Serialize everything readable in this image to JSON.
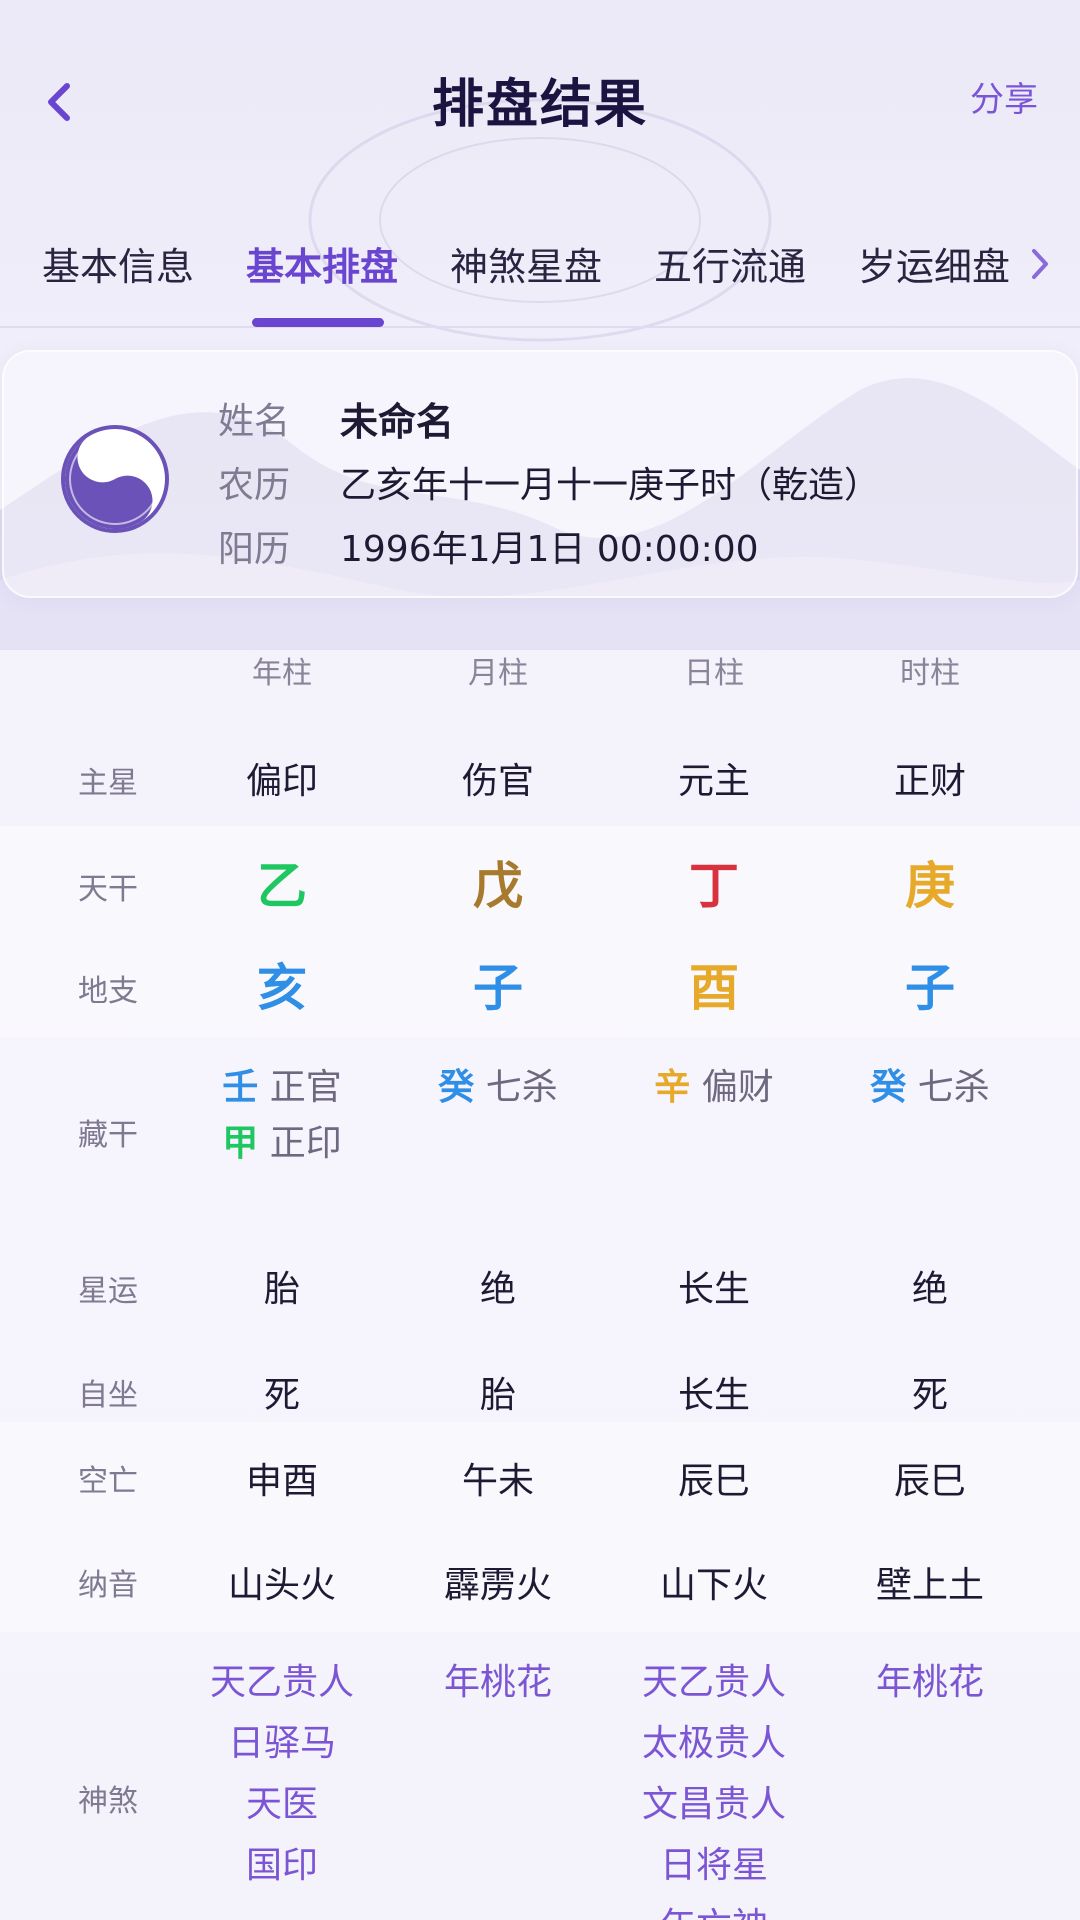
{
  "header": {
    "title": "排盘结果",
    "share_label": "分享"
  },
  "tabs": [
    {
      "label": "基本信息",
      "active": false
    },
    {
      "label": "基本排盘",
      "active": true
    },
    {
      "label": "神煞星盘",
      "active": false
    },
    {
      "label": "五行流通",
      "active": false
    },
    {
      "label": "岁运细盘",
      "active": false
    }
  ],
  "profile": {
    "name_label": "姓名",
    "name_value": "未命名",
    "lunar_label": "农历",
    "lunar_value": "乙亥年十一月十一庚子时（乾造）",
    "solar_label": "阳历",
    "solar_value": "1996年1月1日 00:00:00"
  },
  "columns": [
    "年柱",
    "月柱",
    "日柱",
    "时柱"
  ],
  "rows": {
    "main_star": {
      "label": "主星",
      "values": [
        "偏印",
        "伤官",
        "元主",
        "正财"
      ]
    },
    "heavenly_stem": {
      "label": "天干",
      "values": [
        "乙",
        "戊",
        "丁",
        "庚"
      ]
    },
    "earthly_branch": {
      "label": "地支",
      "values": [
        "亥",
        "子",
        "酉",
        "子"
      ]
    },
    "hidden_stems": {
      "label": "藏干",
      "values": [
        [
          {
            "char": "壬",
            "name": "正官"
          },
          {
            "char": "甲",
            "name": "正印"
          }
        ],
        [
          {
            "char": "癸",
            "name": "七杀"
          }
        ],
        [
          {
            "char": "辛",
            "name": "偏财"
          }
        ],
        [
          {
            "char": "癸",
            "name": "七杀"
          }
        ]
      ]
    },
    "star_fortune": {
      "label": "星运",
      "values": [
        "胎",
        "绝",
        "长生",
        "绝"
      ]
    },
    "self_seat": {
      "label": "自坐",
      "values": [
        "死",
        "胎",
        "长生",
        "死"
      ]
    },
    "void": {
      "label": "空亡",
      "values": [
        "申酉",
        "午未",
        "辰巳",
        "辰巳"
      ]
    },
    "nayin": {
      "label": "纳音",
      "values": [
        "山头火",
        "霹雳火",
        "山下火",
        "壁上土"
      ]
    },
    "shensha": {
      "label": "神煞",
      "values": [
        [
          "天乙贵人",
          "日驿马",
          "天医",
          "国印"
        ],
        [
          "年桃花"
        ],
        [
          "天乙贵人",
          "太极贵人",
          "文昌贵人",
          "日将星",
          "年亡神"
        ],
        [
          "年桃花"
        ]
      ]
    }
  },
  "colors": {
    "accent": "#6a45cf",
    "wood": "#1fc760",
    "earth": "#a87a2e",
    "fire": "#d8323f",
    "metal": "#e6a92a",
    "water": "#2f8fe6"
  }
}
